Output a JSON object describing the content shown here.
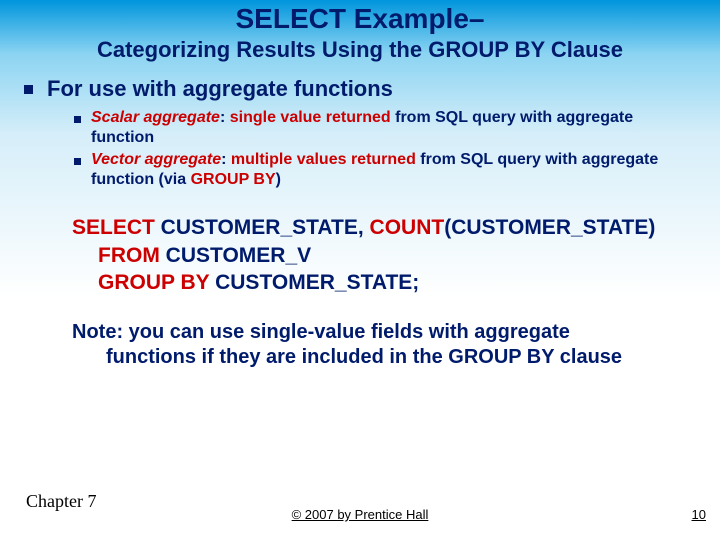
{
  "title": "SELECT Example–",
  "subtitle": "Categorizing Results Using the GROUP BY Clause",
  "main_bullet": "For use with aggregate functions",
  "sub": {
    "scalar_term": "Scalar aggregate",
    "scalar_colon": ": ",
    "scalar_red": "single value returned",
    "scalar_tail": " from SQL query with aggregate function",
    "vector_term": "Vector aggregate",
    "vector_colon": ": ",
    "vector_red": "multiple values returned",
    "vector_tail1": " from SQL query with aggregate function (via ",
    "vector_groupby": "GROUP BY",
    "vector_tail2": ")"
  },
  "code": {
    "l1a": "SELECT",
    "l1b": " CUSTOMER_STATE, ",
    "l1c": "COUNT",
    "l1d": "(CUSTOMER_STATE)",
    "l2a": "FROM",
    "l2b": " CUSTOMER_V",
    "l3a": "GROUP BY",
    "l3b": " CUSTOMER_STATE;"
  },
  "note": {
    "line1": "Note: you can use single-value fields with aggregate",
    "line2": "functions if they are included in the GROUP BY clause"
  },
  "footer": {
    "chapter": "Chapter 7",
    "copyright": "© 2007 by Prentice Hall",
    "page": "10"
  }
}
